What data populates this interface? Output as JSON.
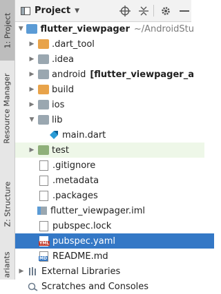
{
  "sidebar": {
    "tabs": [
      {
        "label": "1: Project"
      },
      {
        "label": "Resource Manager"
      },
      {
        "label": "Z: Structure"
      },
      {
        "label": "ariants"
      }
    ]
  },
  "toolbar": {
    "title": "Project"
  },
  "tree": {
    "root": {
      "name": "flutter_viewpager",
      "path": "~/AndroidStu"
    },
    "items": [
      {
        "label": ".dart_tool"
      },
      {
        "label": ".idea"
      },
      {
        "label": "android",
        "suffix": "[flutter_viewpager_a"
      },
      {
        "label": "build"
      },
      {
        "label": "ios"
      },
      {
        "label": "lib"
      },
      {
        "label": "main.dart"
      },
      {
        "label": "test"
      },
      {
        "label": ".gitignore"
      },
      {
        "label": ".metadata"
      },
      {
        "label": ".packages"
      },
      {
        "label": "flutter_viewpager.iml"
      },
      {
        "label": "pubspec.lock"
      },
      {
        "label": "pubspec.yaml"
      },
      {
        "label": "README.md"
      },
      {
        "label": "External Libraries"
      },
      {
        "label": "Scratches and Consoles"
      }
    ]
  },
  "colors": {
    "selection": "#3478c6",
    "orange_folder": "#e8a34a",
    "blue_folder": "#5b9bd5"
  },
  "icons": {
    "badge_yml": "YML",
    "badge_md": "MD"
  }
}
